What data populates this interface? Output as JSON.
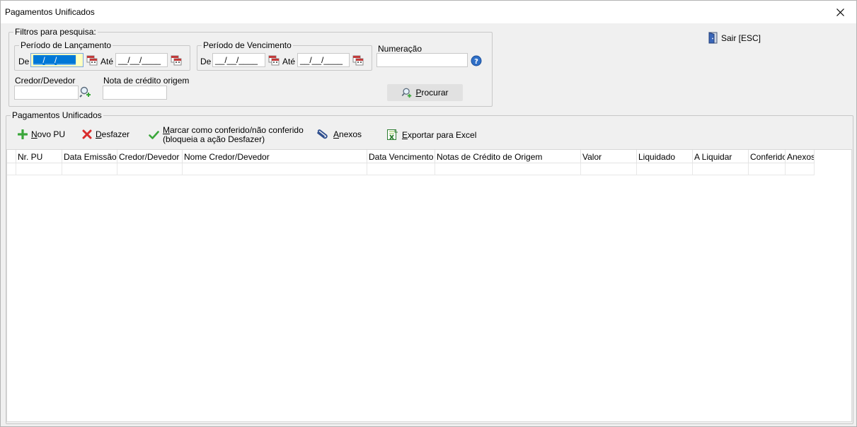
{
  "window": {
    "title": "Pagamentos Unificados"
  },
  "filters": {
    "legend": "Filtros para pesquisa:",
    "lancamento": {
      "legend": "Período de Lançamento",
      "de_label": "De",
      "ate_label": "Até",
      "de_value": "__/__/____",
      "ate_value": "__/__/____"
    },
    "vencimento": {
      "legend": "Período de Vencimento",
      "de_label": "De",
      "ate_label": "Até",
      "de_value": "__/__/____",
      "ate_value": "__/__/____"
    },
    "numeracao_label": "Numeração",
    "numeracao_value": "",
    "credor_label": "Credor/Devedor",
    "credor_value": "",
    "nota_label": "Nota de crédito origem",
    "nota_value": "",
    "procurar_label": "Procurar"
  },
  "sair_label": "Sair [ESC]",
  "section": {
    "legend": "Pagamentos Unificados",
    "toolbar": {
      "novo": "Novo PU",
      "desfazer": "Desfazer",
      "marcar_line1": "Marcar como conferido/não conferido",
      "marcar_line2": "(bloqueia a ação Desfazer)",
      "anexos": "Anexos",
      "exportar": "Exportar para Excel"
    },
    "columns": [
      "Nr. PU",
      "Data Emissão",
      "Credor/Devedor",
      "Nome Credor/Devedor",
      "Data Vencimento",
      "Notas de Crédito de Origem",
      "Valor",
      "Liquidado",
      "A Liquidar",
      "Conferido",
      "Anexos"
    ]
  },
  "colors": {
    "accent": "#0078d7",
    "focus_bg": "#ffffc0",
    "green": "#3aa63a",
    "red": "#d92c2c"
  }
}
